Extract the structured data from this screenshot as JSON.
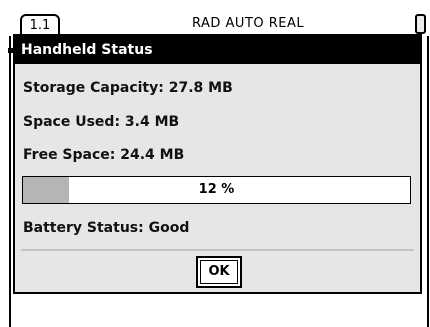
{
  "statusbar": {
    "tab_label": "1.1",
    "modes": "RAD  AUTO  REAL",
    "battery_icon": "battery-icon"
  },
  "dialog": {
    "title": "Handheld Status",
    "storage_capacity": "Storage Capacity: 27.8 MB",
    "space_used": "Space Used: 3.4 MB",
    "free_space": "Free Space: 24.4 MB",
    "progress": {
      "label": "12 %",
      "fraction": 0.12
    },
    "battery_status": "Battery Status: Good",
    "ok_label": "OK"
  },
  "colors": {
    "titlebar_bg": "#000000",
    "dialog_bg": "#e6e6e6",
    "progress_fill": "#b5b5b5"
  }
}
